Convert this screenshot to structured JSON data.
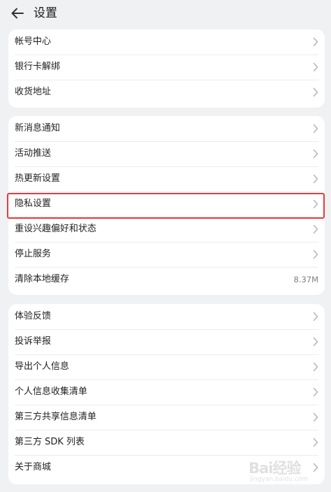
{
  "header": {
    "title": "设置",
    "back_icon": "arrow-left-icon"
  },
  "groups": [
    {
      "items": [
        {
          "label": "帐号中心"
        },
        {
          "label": "银行卡解绑"
        },
        {
          "label": "收货地址"
        }
      ]
    },
    {
      "items": [
        {
          "label": "新消息通知"
        },
        {
          "label": "活动推送"
        },
        {
          "label": "热更新设置"
        },
        {
          "label": "隐私设置"
        },
        {
          "label": "重设兴趣偏好和状态"
        },
        {
          "label": "停止服务"
        },
        {
          "label": "清除本地缓存",
          "value": "8.37M"
        }
      ]
    },
    {
      "items": [
        {
          "label": "体验反馈"
        },
        {
          "label": "投诉举报"
        },
        {
          "label": "导出个人信息"
        },
        {
          "label": "个人信息收集清单"
        },
        {
          "label": "第三方共享信息清单"
        },
        {
          "label": "第三方 SDK 列表"
        },
        {
          "label": "关于商城"
        }
      ]
    }
  ],
  "annotation": {
    "highlight_color": "#e8393a"
  },
  "watermark": {
    "text": "Bai经验",
    "sub": "jingyan.baidu.com"
  },
  "colors": {
    "background": "#f0f1f2",
    "card": "#ffffff",
    "chevron": "#b5b5b5"
  }
}
